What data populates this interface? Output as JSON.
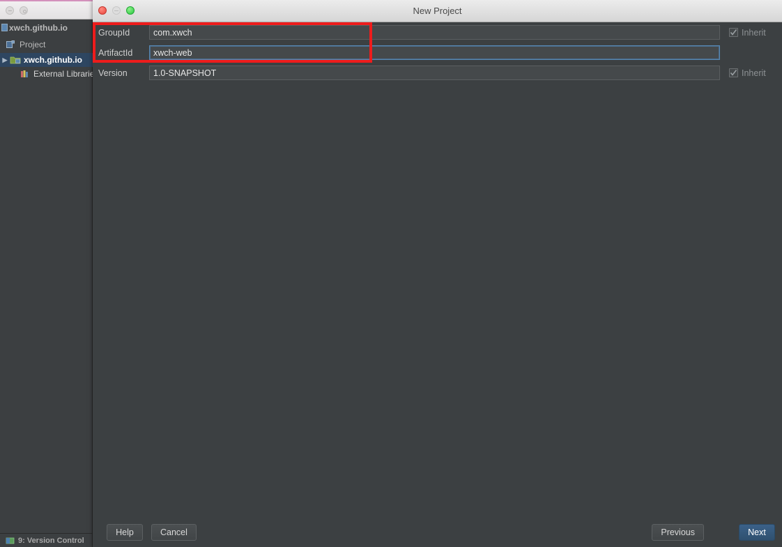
{
  "background_window": {
    "project_tool": {
      "header_label": "xwch.github.io",
      "tab_label": "Project",
      "tab_icon": "project-icon",
      "tree": [
        {
          "label": "xwch.github.io",
          "icon": "module-folder-icon",
          "arrow": "▶",
          "selected": true,
          "depth": 0
        },
        {
          "label": "External Librarie",
          "icon": "libraries-icon",
          "arrow": "",
          "selected": false,
          "depth": 1
        }
      ],
      "status_bar_label": "9: Version Control",
      "status_bar_icon": "version-control-icon"
    }
  },
  "dialog": {
    "title": "New Project",
    "window_controls": {
      "close": "close-window-button",
      "minimize": "minimize-window-button",
      "zoom": "zoom-window-button"
    },
    "form": {
      "rows": [
        {
          "label": "GroupId",
          "value": "com.xwch",
          "placeholder": "",
          "focused": false,
          "inherit": {
            "label": "Inherit",
            "checked": true,
            "enabled": false
          }
        },
        {
          "label": "ArtifactId",
          "value": "xwch-web",
          "placeholder": "",
          "focused": true,
          "inherit": null
        },
        {
          "label": "Version",
          "value": "1.0-SNAPSHOT",
          "placeholder": "",
          "focused": false,
          "inherit": {
            "label": "Inherit",
            "checked": true,
            "enabled": false
          }
        }
      ]
    },
    "footer": {
      "help_label": "Help",
      "cancel_label": "Cancel",
      "previous_label": "Previous",
      "next_label": "Next"
    }
  },
  "annotation": {
    "type": "rectangle-highlight",
    "color": "#ee1c1c"
  }
}
